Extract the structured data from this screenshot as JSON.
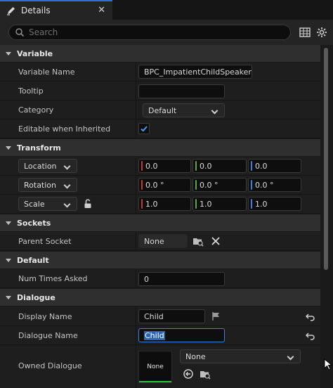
{
  "tab": {
    "title": "Details",
    "close_glyph": "✕",
    "icon": "pencil-icon"
  },
  "search": {
    "placeholder": "Search",
    "value": ""
  },
  "toolbar": {
    "icons": [
      "table-icon",
      "gear-icon"
    ]
  },
  "sections": {
    "variable": "Variable",
    "transform": "Transform",
    "sockets": "Sockets",
    "default": "Default",
    "dialogue": "Dialogue"
  },
  "variable": {
    "name_label": "Variable Name",
    "name_value": "BPC_ImpatientChildSpeaker",
    "tooltip_label": "Tooltip",
    "tooltip_value": "",
    "category_label": "Category",
    "category_value": "Default",
    "editable_label": "Editable when Inherited",
    "editable_checked": true
  },
  "transform": {
    "location": {
      "label": "Location",
      "x": "0.0",
      "y": "0.0",
      "z": "0.0"
    },
    "rotation": {
      "label": "Rotation",
      "x": "0.0 °",
      "y": "0.0 °",
      "z": "0.0 °"
    },
    "scale": {
      "label": "Scale",
      "x": "1.0",
      "y": "1.0",
      "z": "1.0"
    }
  },
  "sockets": {
    "parent_label": "Parent Socket",
    "parent_value": "None"
  },
  "defaults": {
    "times_label": "Num Times Asked",
    "times_value": "0"
  },
  "dialogue": {
    "display_label": "Display Name",
    "display_value": "Child",
    "dialogue_label": "Dialogue Name",
    "dialogue_value": "Child",
    "owned_label": "Owned Dialogue",
    "owned_thumb": "None",
    "owned_value": "None"
  },
  "colors": {
    "accent": "#2f6fd6",
    "x_axis": "#c23b32",
    "y_axis": "#5fa84a",
    "z_axis": "#3c7fd6",
    "asset_ok": "#2fc23a"
  }
}
